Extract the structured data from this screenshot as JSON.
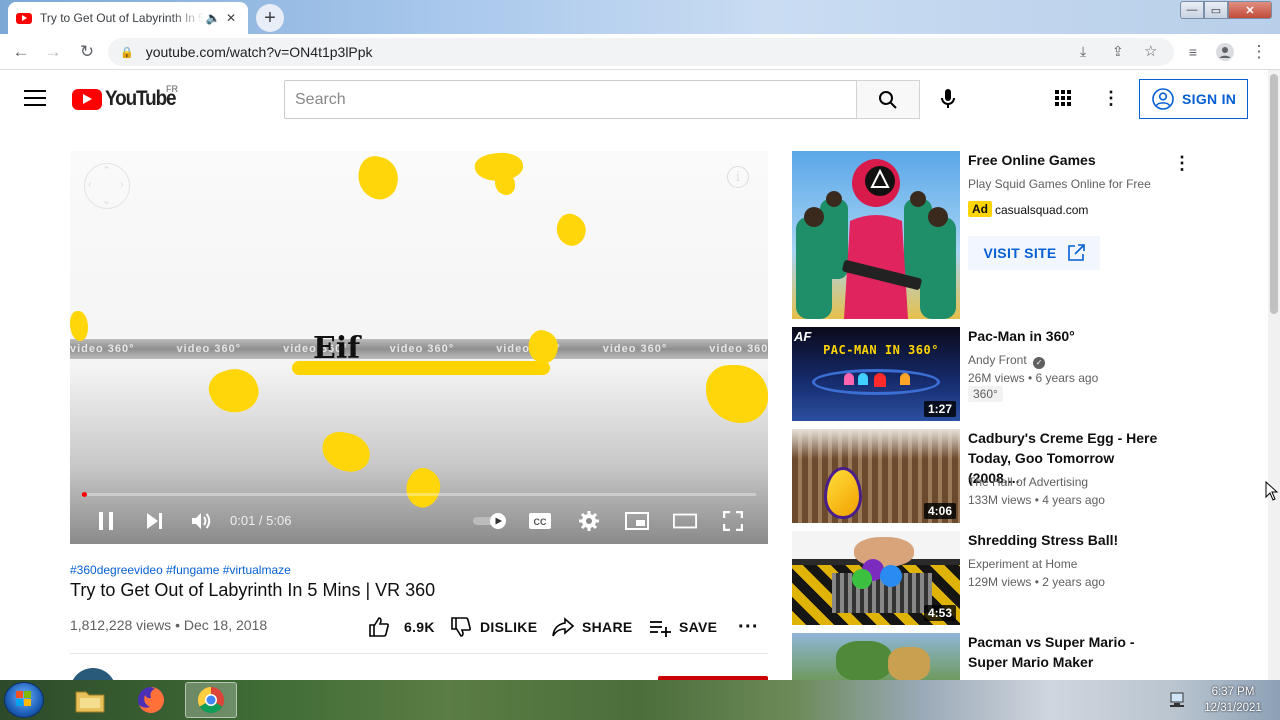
{
  "browser": {
    "tab_title": "Try to Get Out of Labyrinth In 5 Mins | VR 360 - YouTube",
    "url": "youtube.com/watch?v=ON4t1p3lPpk",
    "new_tab_glyph": "+",
    "window": {
      "min": "—",
      "max": "▭",
      "close": "✕"
    }
  },
  "youtube": {
    "logo_text": "YouTube",
    "region": "FR",
    "search_placeholder": "Search",
    "signin_label": "SIGN IN"
  },
  "player": {
    "band_text": "video 360°",
    "overlay_text": "Eif",
    "time": "0:01 / 5:06",
    "progress_fraction": 0.003
  },
  "video": {
    "tags": "#360degreevideo #fungame #virtualmaze",
    "title": "Try to Get Out of Labyrinth In 5 Mins | VR 360",
    "meta": "1,812,228 views • Dec 18, 2018",
    "likes": "6.9K",
    "dislike_label": "DISLIKE",
    "share_label": "SHARE",
    "save_label": "SAVE"
  },
  "sidebar": {
    "ad": {
      "title": "Free Online Games",
      "desc": "Play Squid Games Online for Free",
      "badge": "Ad",
      "domain": "casualsquad.com",
      "visit_label": "VISIT SITE"
    },
    "videos": [
      {
        "title": "Pac-Man in 360°",
        "channel": "Andy Front",
        "stats": "26M views • 6 years ago",
        "duration": "1:27",
        "badge": "360°",
        "thumb_text": "PAC-MAN IN 360°"
      },
      {
        "title": "Cadbury's Creme Egg - Here Today, Goo Tomorrow (2008,...",
        "channel": "The Hall of Advertising",
        "stats": "133M views • 4 years ago",
        "duration": "4:06"
      },
      {
        "title": "Shredding Stress Ball!",
        "channel": "Experiment at Home",
        "stats": "129M views • 2 years ago",
        "duration": "4:53"
      },
      {
        "title": "Pacman vs Super Mario - Super Mario Maker",
        "channel": "",
        "stats": "",
        "duration": ""
      }
    ]
  },
  "taskbar": {
    "time": "6:37 PM",
    "date": "12/31/2021"
  },
  "colors": {
    "yt_red": "#ff0000",
    "link_blue": "#065fd4",
    "ad_yellow": "#fed500"
  }
}
